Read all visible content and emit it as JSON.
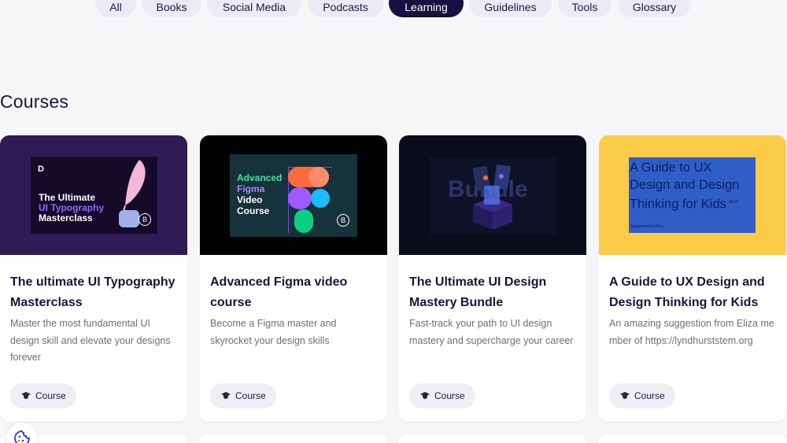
{
  "filters": [
    {
      "label": "All",
      "active": false
    },
    {
      "label": "Books",
      "active": false
    },
    {
      "label": "Social Media",
      "active": false
    },
    {
      "label": "Podcasts",
      "active": false
    },
    {
      "label": "Learning",
      "active": true
    },
    {
      "label": "Guidelines",
      "active": false
    },
    {
      "label": "Tools",
      "active": false
    },
    {
      "label": "Glossary",
      "active": false
    }
  ],
  "section_title": "Courses",
  "cards": [
    {
      "title": "The ultimate UI Typography Masterclass",
      "description": "Master the most fundamental UI design skill and elevate your designs forever",
      "tag": "Course",
      "thumb": {
        "logo": "D",
        "line1": "The Ultimate",
        "line2": "UI Typography",
        "line3": "Masterclass",
        "badge": "B"
      }
    },
    {
      "title": "Advanced Figma video course",
      "description": "Become a Figma master and skyrocket your design skills",
      "tag": "Course",
      "thumb": {
        "line1": "Advanced",
        "line2": "Figma",
        "line3": "Video",
        "line4": "Course",
        "badge": "B"
      }
    },
    {
      "title": "The Ultimate UI Design Mastery Bundle",
      "description": "Fast-track your path to UI design mastery and supercharge your career",
      "tag": "Course",
      "thumb": {
        "word": "Bundle"
      }
    },
    {
      "title": "A Guide to UX Design and Design Thinking for Kids",
      "description": "An amazing suggestion from Eliza member of https://lyndhurststem.org",
      "tag": "Course",
      "thumb": {
        "line1": "A Guide to UX",
        "line2": "Design and Design",
        "line3": "Thinking for Kids",
        "sup": "NEXT",
        "footer": "Suggested by Eliza"
      }
    }
  ],
  "colors": {
    "active_pill": "#15123f",
    "pill": "#ebebf5",
    "accent_yellow": "#fccb48",
    "heading": "#17143f"
  }
}
